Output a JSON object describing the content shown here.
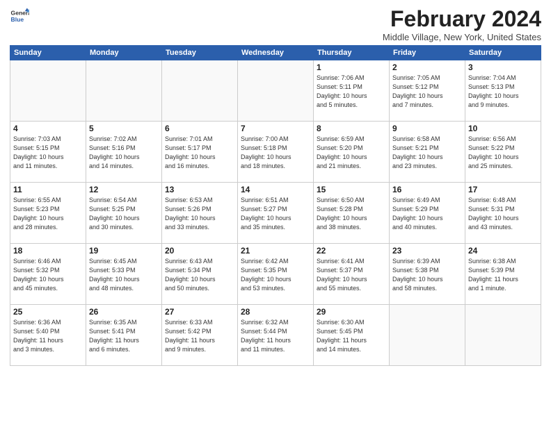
{
  "header": {
    "logo_general": "General",
    "logo_blue": "Blue",
    "month_title": "February 2024",
    "location": "Middle Village, New York, United States"
  },
  "weekdays": [
    "Sunday",
    "Monday",
    "Tuesday",
    "Wednesday",
    "Thursday",
    "Friday",
    "Saturday"
  ],
  "weeks": [
    [
      {
        "day": "",
        "info": ""
      },
      {
        "day": "",
        "info": ""
      },
      {
        "day": "",
        "info": ""
      },
      {
        "day": "",
        "info": ""
      },
      {
        "day": "1",
        "info": "Sunrise: 7:06 AM\nSunset: 5:11 PM\nDaylight: 10 hours\nand 5 minutes."
      },
      {
        "day": "2",
        "info": "Sunrise: 7:05 AM\nSunset: 5:12 PM\nDaylight: 10 hours\nand 7 minutes."
      },
      {
        "day": "3",
        "info": "Sunrise: 7:04 AM\nSunset: 5:13 PM\nDaylight: 10 hours\nand 9 minutes."
      }
    ],
    [
      {
        "day": "4",
        "info": "Sunrise: 7:03 AM\nSunset: 5:15 PM\nDaylight: 10 hours\nand 11 minutes."
      },
      {
        "day": "5",
        "info": "Sunrise: 7:02 AM\nSunset: 5:16 PM\nDaylight: 10 hours\nand 14 minutes."
      },
      {
        "day": "6",
        "info": "Sunrise: 7:01 AM\nSunset: 5:17 PM\nDaylight: 10 hours\nand 16 minutes."
      },
      {
        "day": "7",
        "info": "Sunrise: 7:00 AM\nSunset: 5:18 PM\nDaylight: 10 hours\nand 18 minutes."
      },
      {
        "day": "8",
        "info": "Sunrise: 6:59 AM\nSunset: 5:20 PM\nDaylight: 10 hours\nand 21 minutes."
      },
      {
        "day": "9",
        "info": "Sunrise: 6:58 AM\nSunset: 5:21 PM\nDaylight: 10 hours\nand 23 minutes."
      },
      {
        "day": "10",
        "info": "Sunrise: 6:56 AM\nSunset: 5:22 PM\nDaylight: 10 hours\nand 25 minutes."
      }
    ],
    [
      {
        "day": "11",
        "info": "Sunrise: 6:55 AM\nSunset: 5:23 PM\nDaylight: 10 hours\nand 28 minutes."
      },
      {
        "day": "12",
        "info": "Sunrise: 6:54 AM\nSunset: 5:25 PM\nDaylight: 10 hours\nand 30 minutes."
      },
      {
        "day": "13",
        "info": "Sunrise: 6:53 AM\nSunset: 5:26 PM\nDaylight: 10 hours\nand 33 minutes."
      },
      {
        "day": "14",
        "info": "Sunrise: 6:51 AM\nSunset: 5:27 PM\nDaylight: 10 hours\nand 35 minutes."
      },
      {
        "day": "15",
        "info": "Sunrise: 6:50 AM\nSunset: 5:28 PM\nDaylight: 10 hours\nand 38 minutes."
      },
      {
        "day": "16",
        "info": "Sunrise: 6:49 AM\nSunset: 5:29 PM\nDaylight: 10 hours\nand 40 minutes."
      },
      {
        "day": "17",
        "info": "Sunrise: 6:48 AM\nSunset: 5:31 PM\nDaylight: 10 hours\nand 43 minutes."
      }
    ],
    [
      {
        "day": "18",
        "info": "Sunrise: 6:46 AM\nSunset: 5:32 PM\nDaylight: 10 hours\nand 45 minutes."
      },
      {
        "day": "19",
        "info": "Sunrise: 6:45 AM\nSunset: 5:33 PM\nDaylight: 10 hours\nand 48 minutes."
      },
      {
        "day": "20",
        "info": "Sunrise: 6:43 AM\nSunset: 5:34 PM\nDaylight: 10 hours\nand 50 minutes."
      },
      {
        "day": "21",
        "info": "Sunrise: 6:42 AM\nSunset: 5:35 PM\nDaylight: 10 hours\nand 53 minutes."
      },
      {
        "day": "22",
        "info": "Sunrise: 6:41 AM\nSunset: 5:37 PM\nDaylight: 10 hours\nand 55 minutes."
      },
      {
        "day": "23",
        "info": "Sunrise: 6:39 AM\nSunset: 5:38 PM\nDaylight: 10 hours\nand 58 minutes."
      },
      {
        "day": "24",
        "info": "Sunrise: 6:38 AM\nSunset: 5:39 PM\nDaylight: 11 hours\nand 1 minute."
      }
    ],
    [
      {
        "day": "25",
        "info": "Sunrise: 6:36 AM\nSunset: 5:40 PM\nDaylight: 11 hours\nand 3 minutes."
      },
      {
        "day": "26",
        "info": "Sunrise: 6:35 AM\nSunset: 5:41 PM\nDaylight: 11 hours\nand 6 minutes."
      },
      {
        "day": "27",
        "info": "Sunrise: 6:33 AM\nSunset: 5:42 PM\nDaylight: 11 hours\nand 9 minutes."
      },
      {
        "day": "28",
        "info": "Sunrise: 6:32 AM\nSunset: 5:44 PM\nDaylight: 11 hours\nand 11 minutes."
      },
      {
        "day": "29",
        "info": "Sunrise: 6:30 AM\nSunset: 5:45 PM\nDaylight: 11 hours\nand 14 minutes."
      },
      {
        "day": "",
        "info": ""
      },
      {
        "day": "",
        "info": ""
      }
    ]
  ]
}
